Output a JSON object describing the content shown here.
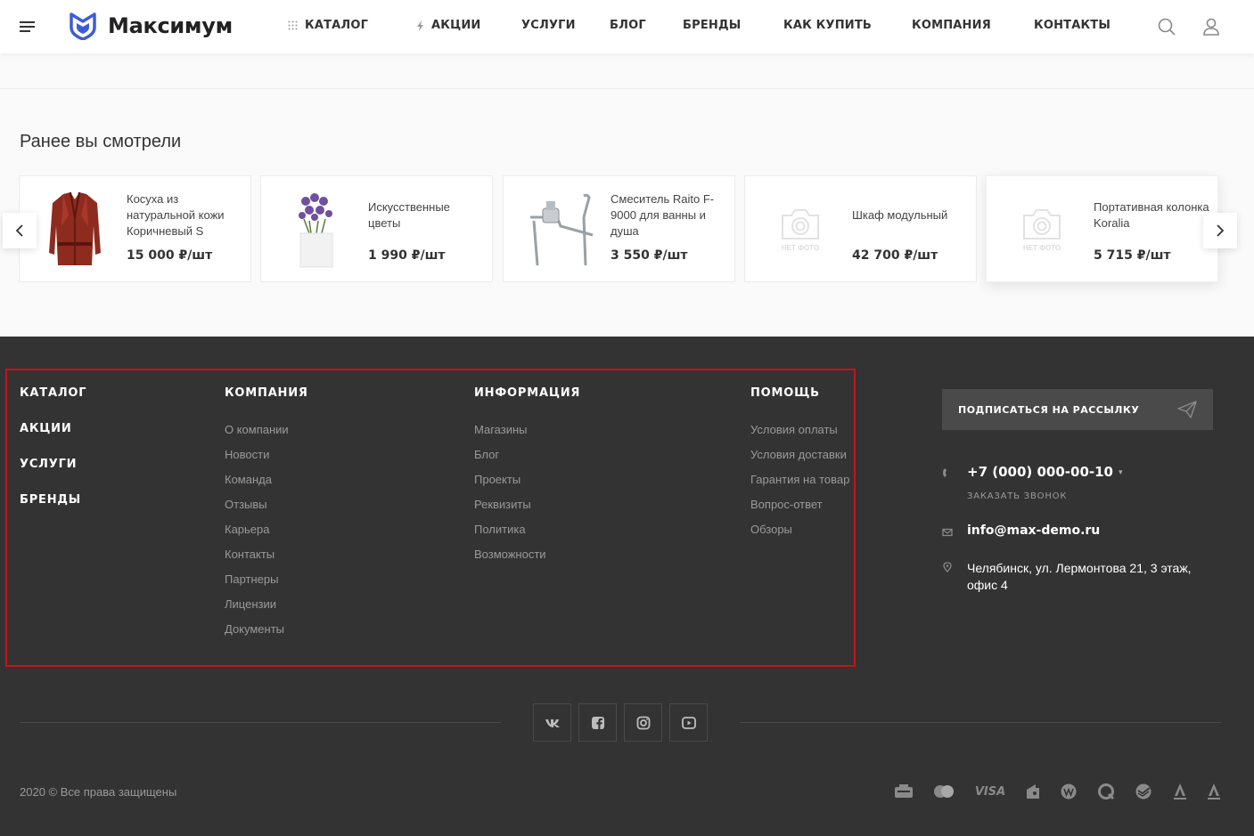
{
  "header": {
    "logo_text": "Максимум",
    "nav": [
      {
        "label": "КАТАЛОГ"
      },
      {
        "label": "АКЦИИ"
      },
      {
        "label": "УСЛУГИ"
      },
      {
        "label": "БЛОГ"
      },
      {
        "label": "БРЕНДЫ"
      },
      {
        "label": "КАК КУПИТЬ"
      },
      {
        "label": "КОМПАНИЯ"
      },
      {
        "label": "КОНТАКТЫ"
      }
    ],
    "icons": [
      "menu-icon",
      "grid-icon",
      "lightning-icon",
      "search-icon",
      "user-icon"
    ],
    "accent_color": "#3d5bd9"
  },
  "recent": {
    "title": "Ранее вы смотрели",
    "items": [
      {
        "name": "Косуха из натуральной кожи Коричневый S",
        "price": "15 000 ₽/шт"
      },
      {
        "name": "Искусственные цветы",
        "price": "1 990 ₽/шт"
      },
      {
        "name": "Смеситель Raito F-9000 для ванны и душа",
        "price": "3 550 ₽/шт"
      },
      {
        "name": "Шкаф модульный",
        "price": "42 700 ₽/шт",
        "no_photo": "НЕТ ФОТО"
      },
      {
        "name": "Портативная колонка Koralia",
        "price": "5 715 ₽/шт",
        "no_photo": "НЕТ ФОТО"
      }
    ]
  },
  "footer": {
    "catalog": {
      "items": [
        "КАТАЛОГ",
        "АКЦИИ",
        "УСЛУГИ",
        "БРЕНДЫ"
      ]
    },
    "company": {
      "title": "КОМПАНИЯ",
      "links": [
        "О компании",
        "Новости",
        "Команда",
        "Отзывы",
        "Карьера",
        "Контакты",
        "Партнеры",
        "Лицензии",
        "Документы"
      ]
    },
    "info": {
      "title": "ИНФОРМАЦИЯ",
      "links": [
        "Магазины",
        "Блог",
        "Проекты",
        "Реквизиты",
        "Политика",
        "Возможности"
      ]
    },
    "help": {
      "title": "ПОМОЩЬ",
      "links": [
        "Условия оплаты",
        "Условия доставки",
        "Гарантия на товар",
        "Вопрос-ответ",
        "Обзоры"
      ]
    },
    "subscribe_label": "ПОДПИСАТЬСЯ НА РАССЫЛКУ",
    "phone": "+7 (000) 000-00-10",
    "callback": "ЗАКАЗАТЬ ЗВОНОК",
    "email": "info@max-demo.ru",
    "address": "Челябинск, ул. Лермонтова 21, 3 этаж, офис 4",
    "social": [
      "vk-icon",
      "facebook-icon",
      "instagram-icon",
      "youtube-icon"
    ],
    "copyright": "2020 © Все права защищены",
    "payments": [
      "card-icon",
      "mastercard-icon",
      "visa-icon",
      "yandex-money-icon",
      "webmoney-icon",
      "qiwi-icon",
      "sberbank-icon",
      "alfa-bank-icon",
      "alfa-click-icon"
    ],
    "payment_visa_text": "VISA",
    "background_color": "#333333"
  }
}
